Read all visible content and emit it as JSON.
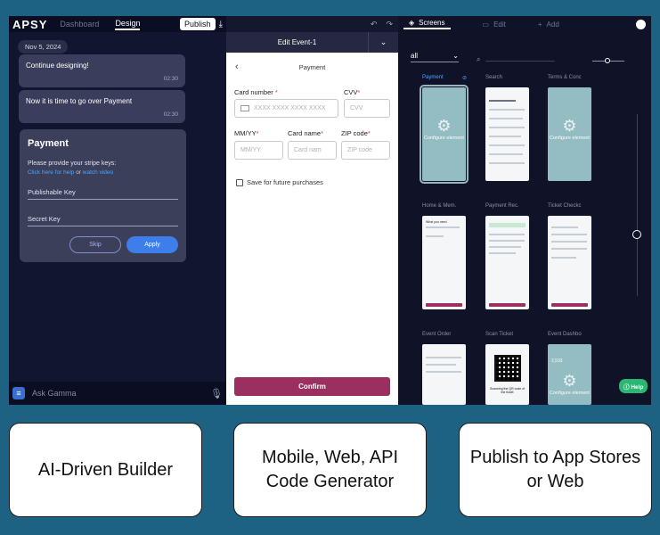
{
  "left": {
    "logo": "APSY",
    "tabs": [
      "Dashboard",
      "Design"
    ],
    "active_tab": "Design",
    "publish_label": "Publish",
    "date_chip": "Nov 5, 2024",
    "messages": [
      {
        "text": "Continue designing!",
        "time": "02:30"
      },
      {
        "text": "Now it is time to go over Payment",
        "time": "02:30"
      }
    ],
    "payment_card": {
      "title": "Payment",
      "prompt": "Please provide your stripe keys:",
      "help_link": "Click here for help",
      "or": "or",
      "video_link": "watch video",
      "fields": [
        "Publishable Key",
        "Secret Key"
      ],
      "skip_label": "Skip",
      "apply_label": "Apply"
    },
    "ask_placeholder": "Ask Gamma"
  },
  "middle": {
    "header_title": "Edit Event-1",
    "page_title": "Payment",
    "card_number_label": "Card number",
    "card_number_placeholder": "XXXX XXXX XXXX XXXX",
    "cvv_label": "CVV",
    "cvv_placeholder": "CVV",
    "mmyy_label": "MM/YY",
    "mmyy_placeholder": "MM/YY",
    "card_name_label": "Card name",
    "card_name_placeholder": "Card nam",
    "zip_label": "ZIP code",
    "zip_placeholder": "ZIP code",
    "required_mark": "*",
    "save_label": "Save for future purchases",
    "confirm_label": "Confirm"
  },
  "right": {
    "tabs": [
      "Screens",
      "Edit",
      "Add"
    ],
    "filter_value": "all",
    "configure_text": "Configure element",
    "screens": [
      {
        "label": "Payment",
        "selected": true
      },
      {
        "label": "Search"
      },
      {
        "label": "Terms & Conc"
      },
      {
        "label": "Home & Mem."
      },
      {
        "label": "Payment Rec."
      },
      {
        "label": "Ticket Checkc"
      },
      {
        "label": "Event Order"
      },
      {
        "label": "Scan Ticket"
      },
      {
        "label": "Event Dashbo"
      }
    ],
    "thumb_text": {
      "home_title": "What you need",
      "event_value": "2,533",
      "scan_caption": "Scanning the QR code of the ticket"
    },
    "help_label": "Help"
  },
  "features": [
    {
      "text": "AI-Driven Builder"
    },
    {
      "text": "Mobile, Web, API Code Generator"
    },
    {
      "text": "Publish to App Stores or Web"
    }
  ],
  "colors": {
    "background": "#1d6283",
    "app_bg": "#0e1128",
    "accent_blue": "#3d7eea",
    "confirm": "#9b2f5f",
    "help": "#2bb673",
    "teal_thumb": "#93bcc3"
  },
  "icons": [
    "download-icon",
    "undo-icon",
    "redo-icon",
    "chevron-down-icon",
    "back-arrow-icon",
    "card-icon",
    "layers-icon",
    "edit-icon",
    "plus-icon",
    "search-icon",
    "mic-icon",
    "chat-icon",
    "link-icon",
    "gear-icon",
    "avatar-icon"
  ]
}
